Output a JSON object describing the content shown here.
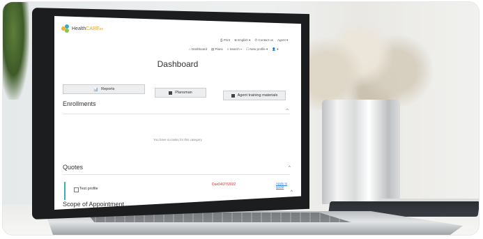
{
  "app": {
    "brand_prefix": "Health",
    "brand_suffix": "CARE",
    "brand_tail": "ex"
  },
  "topnav": {
    "print": "Print",
    "language": "English",
    "contact": "Contact us",
    "user": "Agent"
  },
  "secnav": {
    "dashboard": "Dashboard",
    "plans": "Plans",
    "search": "Search",
    "new_profile": "New profile"
  },
  "page": {
    "title": "Dashboard"
  },
  "quick_actions": {
    "reports": "Reports",
    "plansman": "Plansman",
    "agent_training": "Agent training materials"
  },
  "enrollments": {
    "title": "Enrollments",
    "empty_text": "You have no tasks for this category"
  },
  "quotes": {
    "title": "Quotes",
    "rows": [
      {
        "name": "Test profile",
        "due": "Due04/27/2022",
        "action": "Apply to quote"
      }
    ]
  },
  "scope": {
    "title": "Scope of Appointment"
  },
  "colors": {
    "accent_teal": "#37b0b5",
    "due_red": "#d0312d",
    "link_blue": "#2a7de1",
    "logo_orange": "#e2a52a"
  }
}
